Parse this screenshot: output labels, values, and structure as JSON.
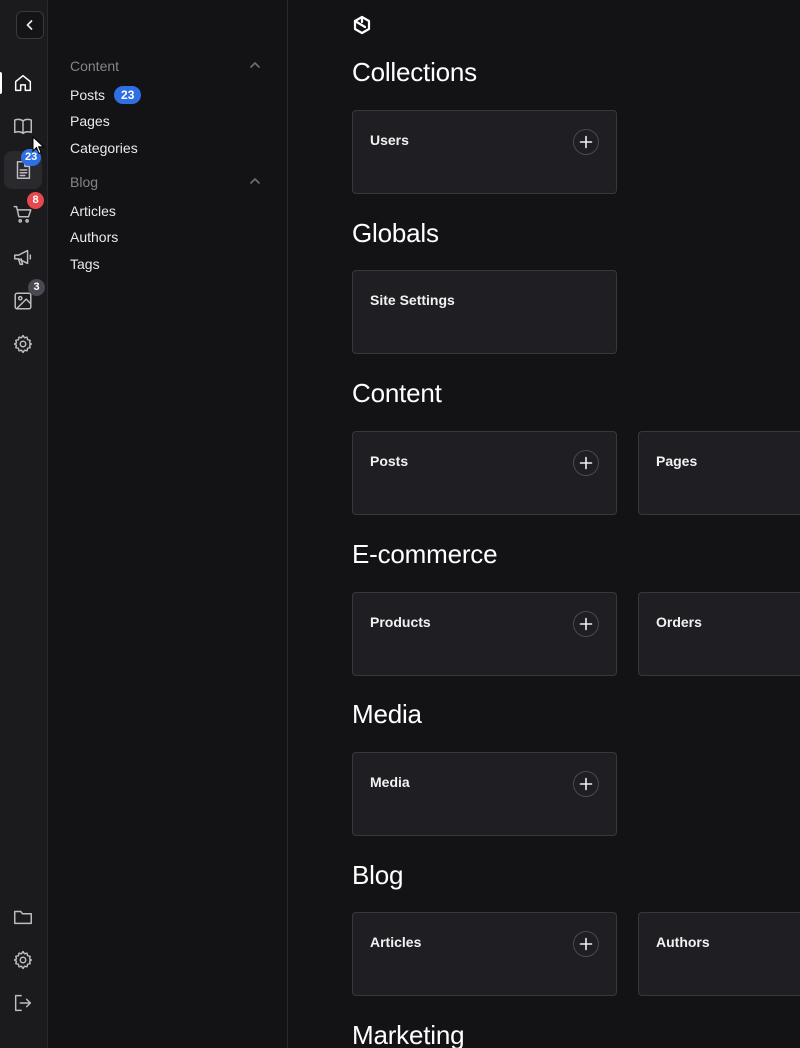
{
  "rail": {
    "badges": {
      "documents": "23",
      "cart": "8",
      "media": "3"
    },
    "colors": {
      "documents_badge": "#2f6fe4",
      "cart_badge": "#e5484d",
      "media_badge": "#4a494f"
    },
    "icons": [
      "chevron-left-icon",
      "home-icon",
      "book-icon",
      "document-icon",
      "cart-icon",
      "megaphone-icon",
      "image-icon",
      "gear-icon",
      "folder-icon",
      "settings-icon",
      "logout-icon"
    ]
  },
  "subnav": {
    "groups": [
      {
        "title": "Content",
        "items": [
          {
            "label": "Posts",
            "badge": "23"
          },
          {
            "label": "Pages"
          },
          {
            "label": "Categories"
          }
        ]
      },
      {
        "title": "Blog",
        "items": [
          {
            "label": "Articles"
          },
          {
            "label": "Authors"
          },
          {
            "label": "Tags"
          }
        ]
      }
    ]
  },
  "main": {
    "sections": [
      {
        "title": "Collections",
        "cards": [
          {
            "label": "Users"
          }
        ]
      },
      {
        "title": "Globals",
        "cards": [
          {
            "label": "Site Settings"
          }
        ]
      },
      {
        "title": "Content",
        "cards": [
          {
            "label": "Posts"
          },
          {
            "label": "Pages"
          }
        ]
      },
      {
        "title": "E-commerce",
        "cards": [
          {
            "label": "Products"
          },
          {
            "label": "Orders"
          }
        ]
      },
      {
        "title": "Media",
        "cards": [
          {
            "label": "Media"
          }
        ]
      },
      {
        "title": "Blog",
        "cards": [
          {
            "label": "Articles"
          },
          {
            "label": "Authors"
          }
        ]
      },
      {
        "title": "Marketing"
      }
    ]
  }
}
